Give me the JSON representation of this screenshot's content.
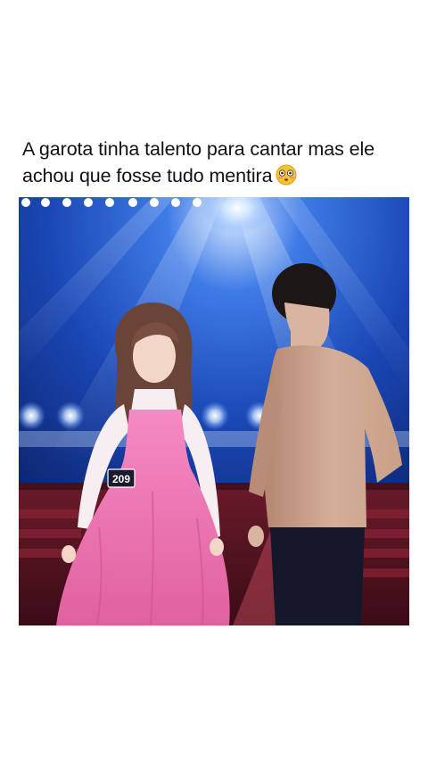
{
  "post": {
    "caption_line1": "A garota tinha talento para cantar mas ele",
    "caption_line2": "achou que fosse tudo mentira",
    "caption_emoji": "flushed-face-emoji"
  },
  "media": {
    "contestant_number": "209",
    "colors": {
      "stage_blue": "#1a4fbf",
      "dress_pink": "#f07ab8",
      "jacket_tan": "#c9a088"
    }
  }
}
